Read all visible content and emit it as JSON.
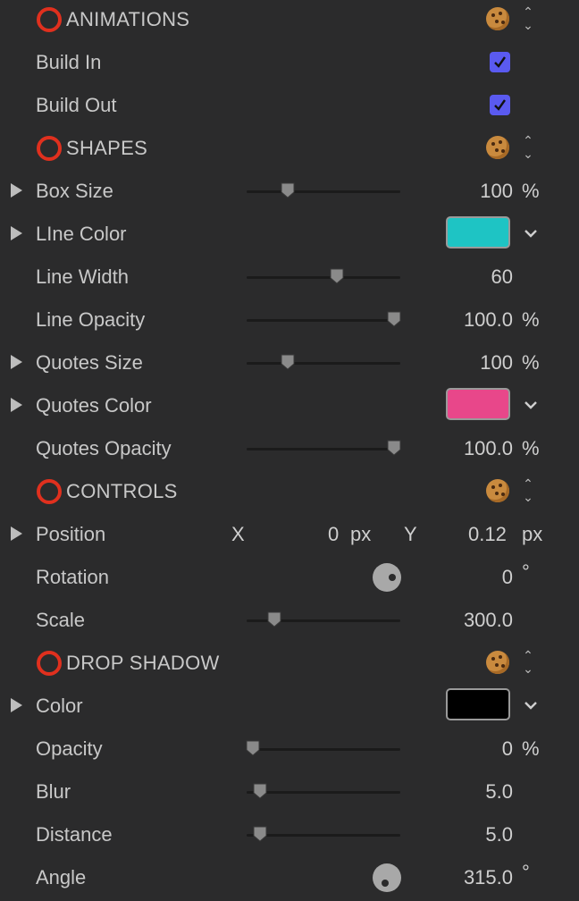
{
  "sections": {
    "animations": {
      "title": "ANIMATIONS",
      "build_in": "Build In",
      "build_out": "Build Out",
      "build_in_checked": true,
      "build_out_checked": true
    },
    "shapes": {
      "title": "SHAPES",
      "box_size": {
        "label": "Box Size",
        "value": "100",
        "unit": "%",
        "level": 0.27
      },
      "line_color": {
        "label": "LIne Color",
        "color": "#1ec4c4"
      },
      "line_width": {
        "label": "Line Width",
        "value": "60",
        "level": 0.59
      },
      "line_opacity": {
        "label": "Line Opacity",
        "value": "100.0",
        "unit": "%",
        "level": 0.96
      },
      "quotes_size": {
        "label": "Quotes Size",
        "value": "100",
        "unit": "%",
        "level": 0.27
      },
      "quotes_color": {
        "label": "Quotes Color",
        "color": "#e8478a"
      },
      "quotes_opacity": {
        "label": "Quotes Opacity",
        "value": "100.0",
        "unit": "%",
        "level": 0.96
      }
    },
    "controls": {
      "title": "CONTROLS",
      "position": {
        "label": "Position",
        "x_label": "X",
        "x_value": "0",
        "x_unit": "px",
        "y_label": "Y",
        "y_value": "0.12",
        "y_unit": "px"
      },
      "rotation": {
        "label": "Rotation",
        "value": "0",
        "unit": "°"
      },
      "scale": {
        "label": "Scale",
        "value": "300.0",
        "level": 0.18
      }
    },
    "drop_shadow": {
      "title": "DROP SHADOW",
      "color": {
        "label": "Color",
        "color": "#000000"
      },
      "opacity": {
        "label": "Opacity",
        "value": "0",
        "unit": "%",
        "level": 0.04
      },
      "blur": {
        "label": "Blur",
        "value": "5.0",
        "level": 0.09
      },
      "distance": {
        "label": "Distance",
        "value": "5.0",
        "level": 0.09
      },
      "angle": {
        "label": "Angle",
        "value": "315.0",
        "unit": "°"
      }
    }
  },
  "icons": {
    "section": "red-ring-icon",
    "preset": "cookie-icon",
    "stepper": "up-down-stepper-icon",
    "disclosure": "disclosure-triangle-icon",
    "popup": "chevron-down-icon",
    "dial": "rotation-dial-icon"
  },
  "colors": {
    "background": "#2b2b2c",
    "checkbox": "#5a5af0",
    "section_ring": "#e0301e"
  }
}
